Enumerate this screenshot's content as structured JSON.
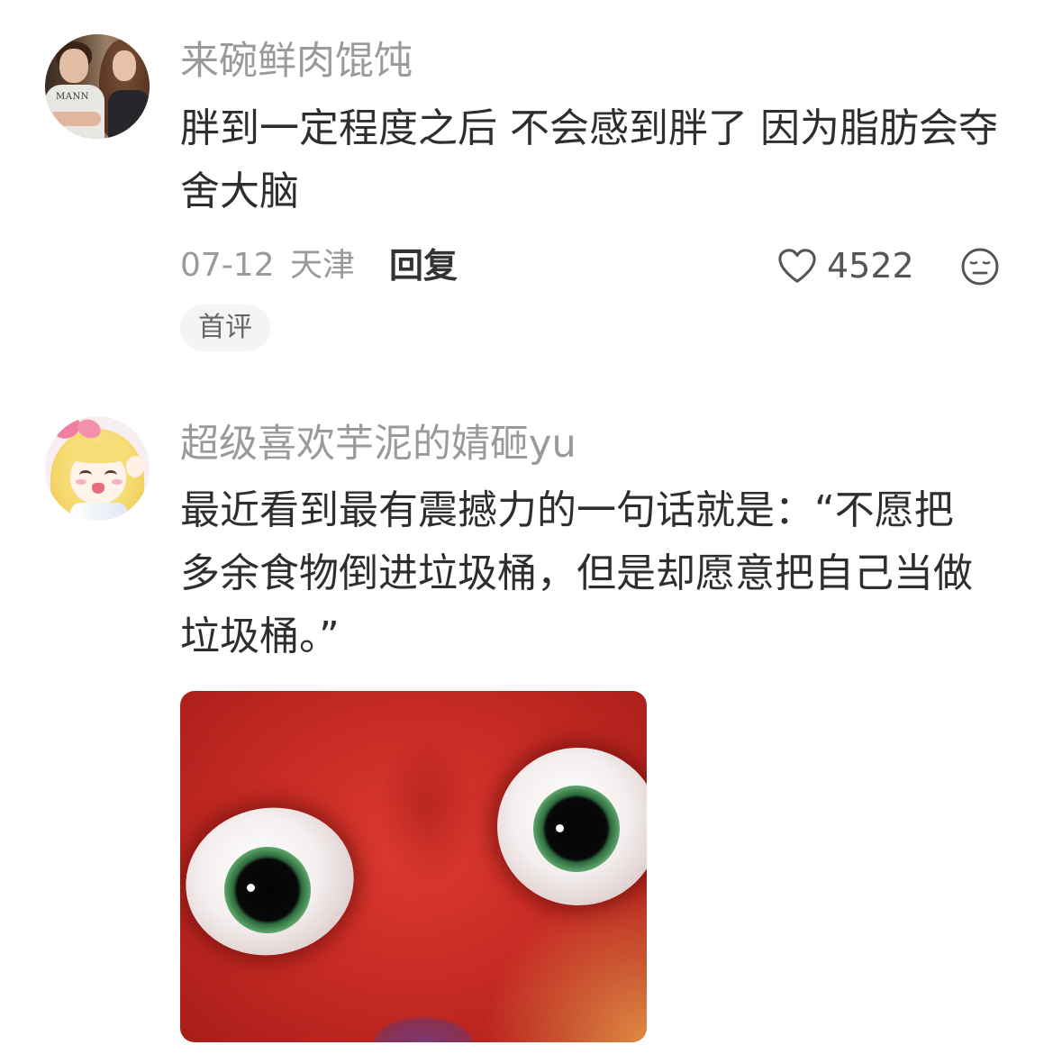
{
  "comments": [
    {
      "username": "来碗鲜肉馄饨",
      "content_lines": [
        "胖到一定程度之后 不会感到胖了 因为脂肪会夺",
        "舍大脑"
      ],
      "date": "07-12",
      "location": "天津",
      "reply_label": "回复",
      "like_count": "4522",
      "badge": "首评",
      "avatar_shirt_text": "MANN"
    },
    {
      "username": "超级喜欢芋泥的婧砸yu",
      "content_lines": [
        "最近看到最有震撼力的一句话就是：“不愿把",
        "多余食物倒进垃圾桶，但是却愿意把自己当做",
        "垃圾桶。”"
      ]
    }
  ],
  "icons": {
    "like": "heart-outline-icon",
    "dislike": "neutral-face-icon"
  },
  "colors": {
    "background": "#ffffff",
    "username": "#9a9a9a",
    "content": "#2e2e2e",
    "meta": "#9a9a9a",
    "reply": "#333333",
    "badge_background": "#f4f4f4",
    "badge_text": "#666666",
    "icon": "#555555"
  }
}
